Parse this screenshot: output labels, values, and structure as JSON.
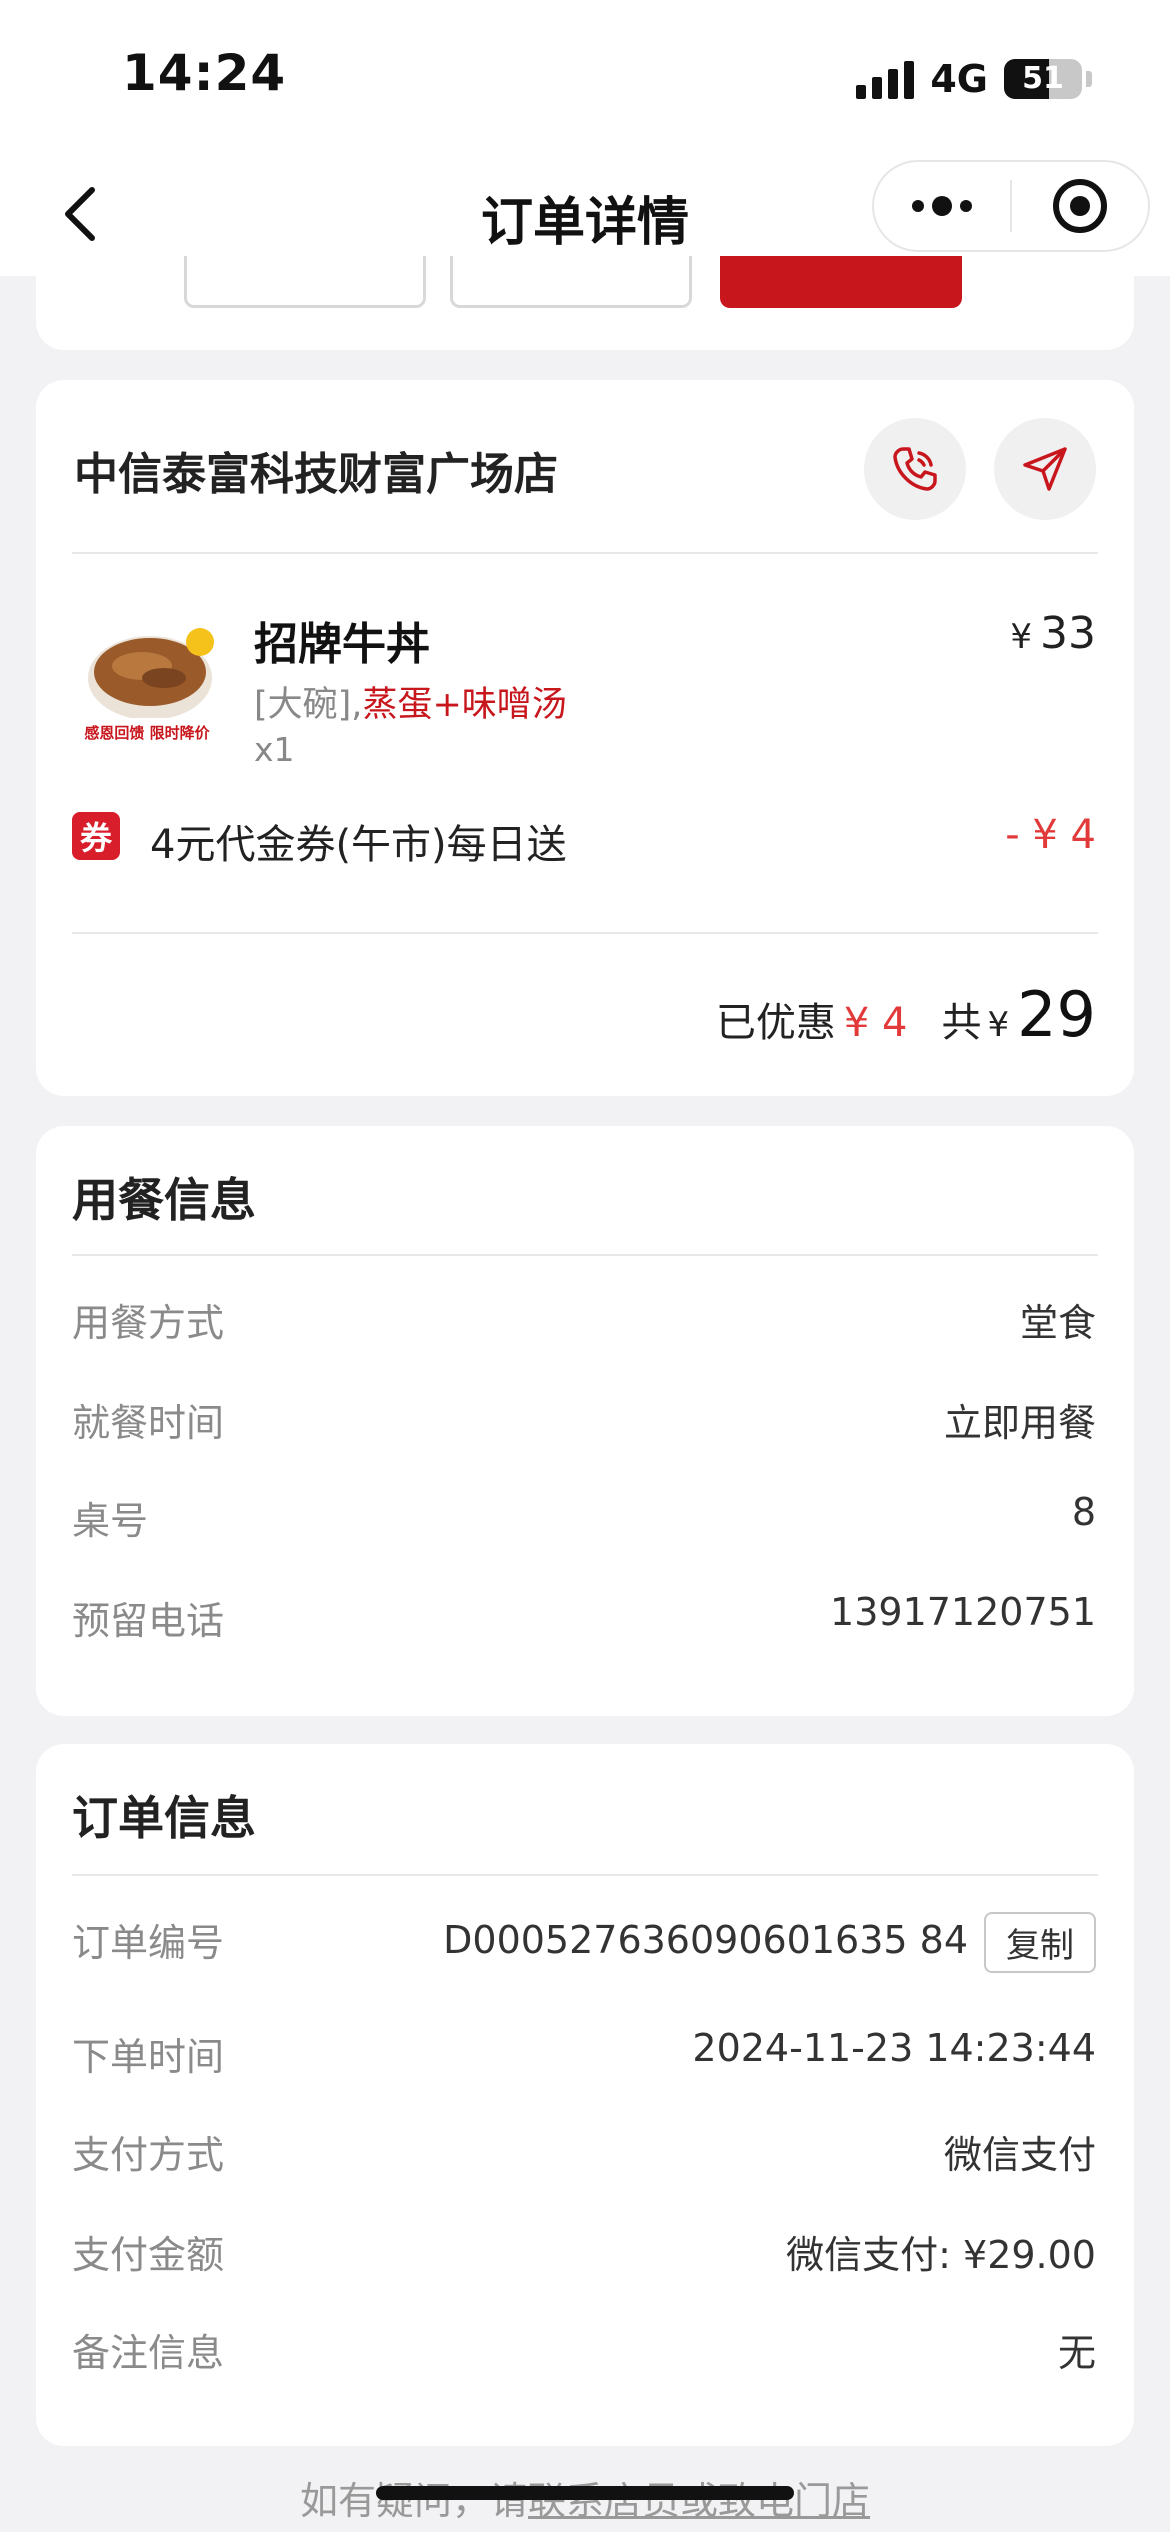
{
  "status_bar": {
    "time": "14:24",
    "network": "4G",
    "battery": "51"
  },
  "nav": {
    "title": "订单详情"
  },
  "store": {
    "name": "中信泰富科技财富广场店"
  },
  "order_item": {
    "name": "招牌牛丼",
    "currency": "¥",
    "price": "33",
    "spec_size": "[大碗],",
    "spec_addon": "蒸蛋+味噌汤",
    "quantity": "x1",
    "image_caption": "感恩回馈 限时降价"
  },
  "coupon": {
    "badge": "券",
    "name": "4元代金券(午市)每日送",
    "amount": "- ¥ 4"
  },
  "totals": {
    "discount_label": "已优惠",
    "discount_value": "¥ 4",
    "total_label": "共",
    "currency": "¥",
    "total_value": "29"
  },
  "dining_info": {
    "title": "用餐信息",
    "rows": [
      {
        "label": "用餐方式",
        "value": "堂食"
      },
      {
        "label": "就餐时间",
        "value": "立即用餐"
      },
      {
        "label": "桌号",
        "value": "8"
      },
      {
        "label": "预留电话",
        "value": "13917120751"
      }
    ]
  },
  "order_info": {
    "title": "订单信息",
    "copy_label": "复制",
    "rows": [
      {
        "label": "订单编号",
        "value": "D000527636090601635 84"
      },
      {
        "label": "下单时间",
        "value": "2024-11-23 14:23:44"
      },
      {
        "label": "支付方式",
        "value": "微信支付"
      },
      {
        "label": "支付金额",
        "value": "微信支付: ¥29.00"
      },
      {
        "label": "备注信息",
        "value": "无"
      }
    ]
  },
  "footer": {
    "text": "如有疑问，请",
    "link": "联系店员或致电门店"
  },
  "colors": {
    "accent_red": "#c8161d",
    "price_red": "#e23a3a",
    "background": "#f2f2f4"
  }
}
